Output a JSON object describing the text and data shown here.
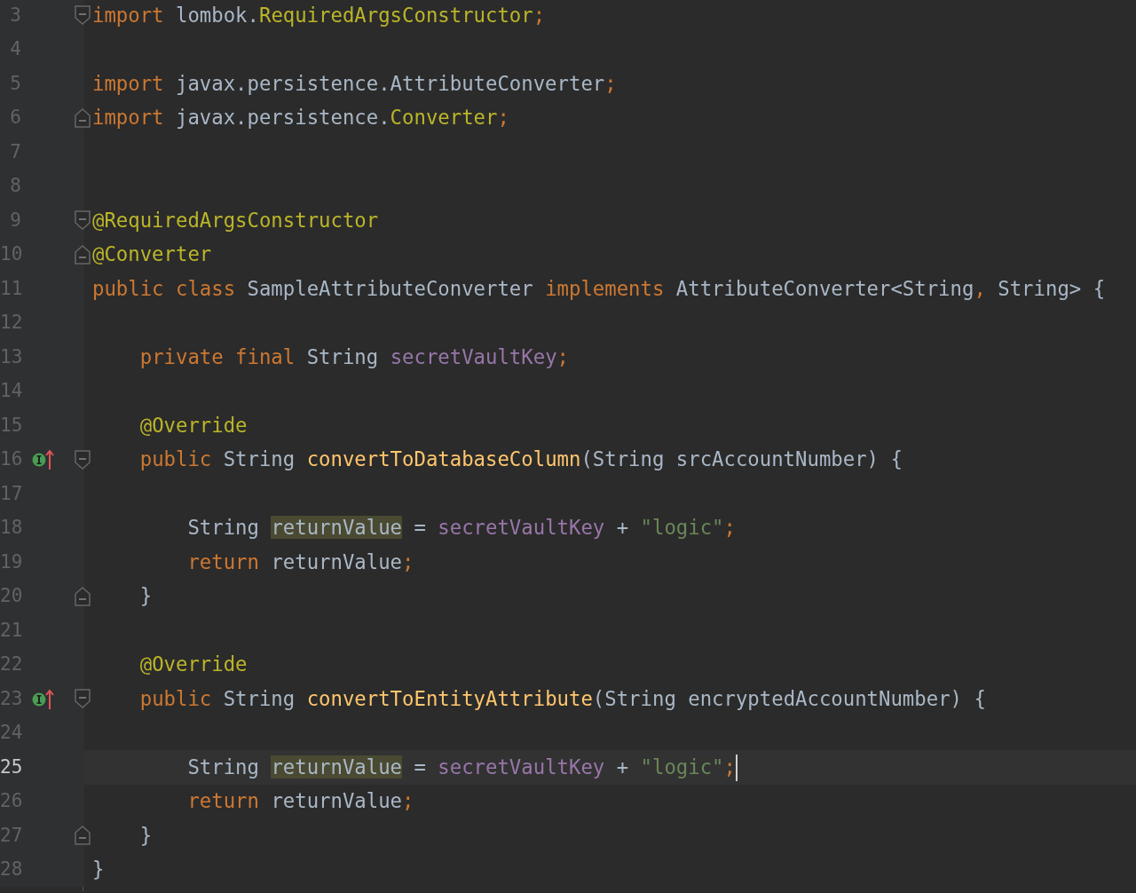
{
  "editor": {
    "lines": [
      {
        "number": "3",
        "fold_start": true,
        "fold_end": false,
        "implements_marker": false,
        "current": false,
        "cursor": false,
        "tokens": [
          {
            "text": "import",
            "kind": "keyword"
          },
          {
            "text": " lombok.",
            "kind": "plain"
          },
          {
            "text": "RequiredArgsConstructor",
            "kind": "annotation"
          },
          {
            "text": ";",
            "kind": "punct"
          }
        ]
      },
      {
        "number": "4",
        "fold_start": false,
        "fold_end": false,
        "implements_marker": false,
        "current": false,
        "cursor": false
      },
      {
        "number": "5",
        "fold_start": false,
        "fold_end": false,
        "implements_marker": false,
        "current": false,
        "cursor": false,
        "tokens": [
          {
            "text": "import",
            "kind": "keyword"
          },
          {
            "text": " javax.persistence.AttributeConverter",
            "kind": "plain"
          },
          {
            "text": ";",
            "kind": "punct"
          }
        ]
      },
      {
        "number": "6",
        "fold_start": false,
        "fold_end": true,
        "implements_marker": false,
        "current": false,
        "cursor": false,
        "tokens": [
          {
            "text": "import",
            "kind": "keyword"
          },
          {
            "text": " javax.persistence.",
            "kind": "plain"
          },
          {
            "text": "Converter",
            "kind": "annotation"
          },
          {
            "text": ";",
            "kind": "punct"
          }
        ]
      },
      {
        "number": "7",
        "fold_start": false,
        "fold_end": false,
        "implements_marker": false,
        "current": false,
        "cursor": false
      },
      {
        "number": "8",
        "fold_start": false,
        "fold_end": false,
        "implements_marker": false,
        "current": false,
        "cursor": false
      },
      {
        "number": "9",
        "fold_start": true,
        "fold_end": false,
        "implements_marker": false,
        "current": false,
        "cursor": false,
        "tokens": [
          {
            "text": "@RequiredArgsConstructor",
            "kind": "annotation"
          }
        ]
      },
      {
        "number": "10",
        "fold_start": false,
        "fold_end": true,
        "implements_marker": false,
        "current": false,
        "cursor": false,
        "tokens": [
          {
            "text": "@Converter",
            "kind": "annotation"
          }
        ]
      },
      {
        "number": "11",
        "fold_start": false,
        "fold_end": false,
        "implements_marker": false,
        "current": false,
        "cursor": false,
        "tokens": [
          {
            "text": "public class",
            "kind": "keyword"
          },
          {
            "text": " SampleAttributeConverter ",
            "kind": "plain"
          },
          {
            "text": "implements",
            "kind": "keyword"
          },
          {
            "text": " AttributeConverter<String",
            "kind": "plain"
          },
          {
            "text": ",",
            "kind": "punct"
          },
          {
            "text": " String> {",
            "kind": "plain"
          }
        ]
      },
      {
        "number": "12",
        "fold_start": false,
        "fold_end": false,
        "implements_marker": false,
        "current": false,
        "cursor": false
      },
      {
        "number": "13",
        "fold_start": false,
        "fold_end": false,
        "implements_marker": false,
        "current": false,
        "cursor": false,
        "tokens": [
          {
            "text": "    private final",
            "kind": "keyword"
          },
          {
            "text": " String ",
            "kind": "plain"
          },
          {
            "text": "secretVaultKey",
            "kind": "field"
          },
          {
            "text": ";",
            "kind": "punct"
          }
        ]
      },
      {
        "number": "14",
        "fold_start": false,
        "fold_end": false,
        "implements_marker": false,
        "current": false,
        "cursor": false
      },
      {
        "number": "15",
        "fold_start": false,
        "fold_end": false,
        "implements_marker": false,
        "current": false,
        "cursor": false,
        "tokens": [
          {
            "text": "    @Override",
            "kind": "annotation"
          }
        ]
      },
      {
        "number": "16",
        "fold_start": true,
        "fold_end": false,
        "implements_marker": true,
        "current": false,
        "cursor": false,
        "tokens": [
          {
            "text": "    public",
            "kind": "keyword"
          },
          {
            "text": " String ",
            "kind": "plain"
          },
          {
            "text": "convertToDatabaseColumn",
            "kind": "method"
          },
          {
            "text": "(String srcAccountNumber) {",
            "kind": "plain"
          }
        ]
      },
      {
        "number": "17",
        "fold_start": false,
        "fold_end": false,
        "implements_marker": false,
        "current": false,
        "cursor": false
      },
      {
        "number": "18",
        "fold_start": false,
        "fold_end": false,
        "implements_marker": false,
        "current": false,
        "cursor": false,
        "tokens": [
          {
            "text": "        String ",
            "kind": "plain"
          },
          {
            "text": "returnValue",
            "kind": "plain",
            "highlighted": true
          },
          {
            "text": " = ",
            "kind": "plain"
          },
          {
            "text": "secretVaultKey",
            "kind": "field"
          },
          {
            "text": " + ",
            "kind": "plain"
          },
          {
            "text": "\"logic\"",
            "kind": "string"
          },
          {
            "text": ";",
            "kind": "punct"
          }
        ]
      },
      {
        "number": "19",
        "fold_start": false,
        "fold_end": false,
        "implements_marker": false,
        "current": false,
        "cursor": false,
        "tokens": [
          {
            "text": "        return",
            "kind": "keyword"
          },
          {
            "text": " returnValue",
            "kind": "plain"
          },
          {
            "text": ";",
            "kind": "punct"
          }
        ]
      },
      {
        "number": "20",
        "fold_start": false,
        "fold_end": true,
        "implements_marker": false,
        "current": false,
        "cursor": false,
        "tokens": [
          {
            "text": "    }",
            "kind": "plain"
          }
        ]
      },
      {
        "number": "21",
        "fold_start": false,
        "fold_end": false,
        "implements_marker": false,
        "current": false,
        "cursor": false
      },
      {
        "number": "22",
        "fold_start": false,
        "fold_end": false,
        "implements_marker": false,
        "current": false,
        "cursor": false,
        "tokens": [
          {
            "text": "    @Override",
            "kind": "annotation"
          }
        ]
      },
      {
        "number": "23",
        "fold_start": true,
        "fold_end": false,
        "implements_marker": true,
        "current": false,
        "cursor": false,
        "tokens": [
          {
            "text": "    public",
            "kind": "keyword"
          },
          {
            "text": " String ",
            "kind": "plain"
          },
          {
            "text": "convertToEntityAttribute",
            "kind": "method"
          },
          {
            "text": "(String encryptedAccountNumber) {",
            "kind": "plain"
          }
        ]
      },
      {
        "number": "24",
        "fold_start": false,
        "fold_end": false,
        "implements_marker": false,
        "current": false,
        "cursor": false
      },
      {
        "number": "25",
        "fold_start": false,
        "fold_end": false,
        "implements_marker": false,
        "current": true,
        "cursor": true,
        "tokens": [
          {
            "text": "        String ",
            "kind": "plain"
          },
          {
            "text": "returnValue",
            "kind": "plain",
            "highlighted": true
          },
          {
            "text": " = ",
            "kind": "plain"
          },
          {
            "text": "secretVaultKey",
            "kind": "field"
          },
          {
            "text": " + ",
            "kind": "plain"
          },
          {
            "text": "\"logic\"",
            "kind": "string"
          },
          {
            "text": ";",
            "kind": "punct"
          }
        ]
      },
      {
        "number": "26",
        "fold_start": false,
        "fold_end": false,
        "implements_marker": false,
        "current": false,
        "cursor": false,
        "tokens": [
          {
            "text": "        return",
            "kind": "keyword"
          },
          {
            "text": " returnValue",
            "kind": "plain"
          },
          {
            "text": ";",
            "kind": "punct"
          }
        ]
      },
      {
        "number": "27",
        "fold_start": false,
        "fold_end": true,
        "implements_marker": false,
        "current": false,
        "cursor": false,
        "tokens": [
          {
            "text": "    }",
            "kind": "plain"
          }
        ]
      },
      {
        "number": "28",
        "fold_start": false,
        "fold_end": false,
        "implements_marker": false,
        "current": false,
        "cursor": false,
        "tokens": [
          {
            "text": "}",
            "kind": "plain"
          }
        ]
      }
    ]
  }
}
